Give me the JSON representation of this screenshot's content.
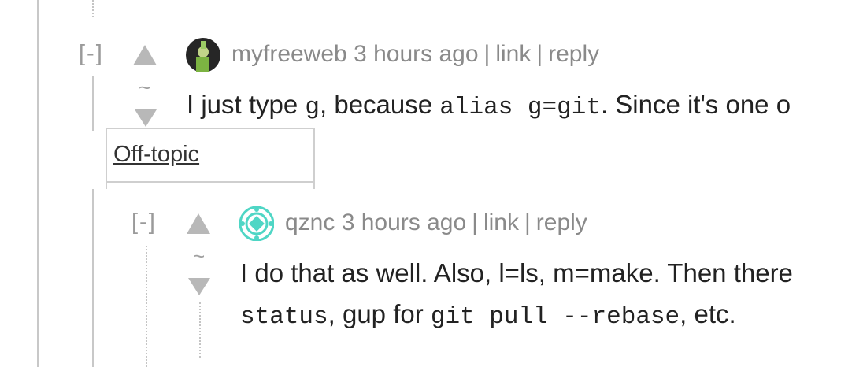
{
  "comments": [
    {
      "collapse_label": "[-]",
      "vote_separator": "~",
      "username": "myfreeweb",
      "age": "3 hours ago",
      "link_label": "link",
      "reply_label": "reply",
      "sep": "|",
      "text_parts": [
        "I just type ",
        "g",
        ", because ",
        "alias g=git",
        ". Since it's one o"
      ],
      "avatar_icon": "user-avatar-icon",
      "menu": {
        "items": [
          "Off-topic"
        ]
      }
    },
    {
      "collapse_label": "[-]",
      "vote_separator": "~",
      "username": "qznc",
      "age": "3 hours ago",
      "link_label": "link",
      "reply_label": "reply",
      "sep": "|",
      "text_line1": "I do that as well. Also, l=ls, m=make. Then there",
      "text_line2_parts": [
        "status",
        ", gup for ",
        "git pull --rebase",
        ", etc."
      ],
      "avatar_icon": "geometric-avatar-icon"
    }
  ],
  "colors": {
    "avatar_green": "#7cb342",
    "avatar_teal": "#4fd6c5"
  }
}
